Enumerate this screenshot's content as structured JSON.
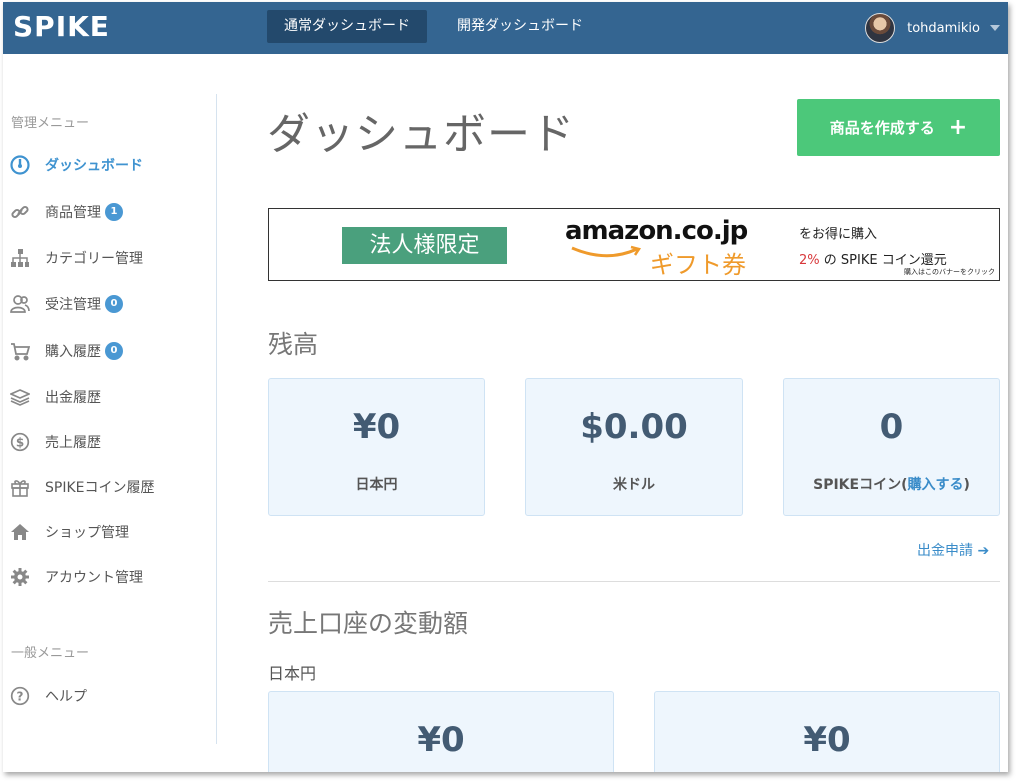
{
  "header": {
    "logo": "SPIKE",
    "tabs": [
      {
        "label": "通常ダッシュボード"
      },
      {
        "label": "開発ダッシュボード"
      }
    ],
    "username": "tohdamikio"
  },
  "sidebar": {
    "admin_heading": "管理メニュー",
    "items": [
      {
        "label": "ダッシュボード",
        "icon": "dashboard-icon"
      },
      {
        "label": "商品管理",
        "icon": "link-icon",
        "badge": "1"
      },
      {
        "label": "カテゴリー管理",
        "icon": "sitemap-icon"
      },
      {
        "label": "受注管理",
        "icon": "users-icon",
        "badge": "0"
      },
      {
        "label": "購入履歴",
        "icon": "cart-icon",
        "badge": "0"
      },
      {
        "label": "出金履歴",
        "icon": "layers-icon"
      },
      {
        "label": "売上履歴",
        "icon": "dollar-icon"
      },
      {
        "label": "SPIKEコイン履歴",
        "icon": "gift-icon"
      },
      {
        "label": "ショップ管理",
        "icon": "home-icon"
      },
      {
        "label": "アカウント管理",
        "icon": "gear-icon"
      }
    ],
    "general_heading": "一般メニュー",
    "general_items": [
      {
        "label": "ヘルプ",
        "icon": "question-icon"
      }
    ]
  },
  "main": {
    "title": "ダッシュボード",
    "create_button": "商品を作成する",
    "banner": {
      "badge": "法人様限定",
      "amazon": "amazon.co.jp",
      "gift": "ギフト券",
      "buy_text": "をお得に購入",
      "coin_pct": "2%",
      "coin_text": "の SPIKE コイン還元",
      "note": "購入はこのバナーをクリック"
    },
    "balance_heading": "残高",
    "balances": [
      {
        "amount": "¥0",
        "label": "日本円"
      },
      {
        "amount": "$0.00",
        "label": "米ドル"
      },
      {
        "amount": "0",
        "label_prefix": "SPIKEコイン(",
        "label_link": "購入する",
        "label_suffix": ")"
      }
    ],
    "withdraw_link": "出金申請",
    "sales_heading": "売上口座の変動額",
    "sales_currency": "日本円",
    "sales_cards": [
      {
        "amount": "¥0"
      },
      {
        "amount": "¥0"
      }
    ]
  },
  "colors": {
    "header_bg": "#346591",
    "active_tab": "#23496c",
    "accent_blue": "#3f93d0",
    "create_green": "#4cc87a",
    "card_bg": "#eef6fd",
    "banner_green": "#4aa07d",
    "gift_orange": "#ef9a2b"
  }
}
